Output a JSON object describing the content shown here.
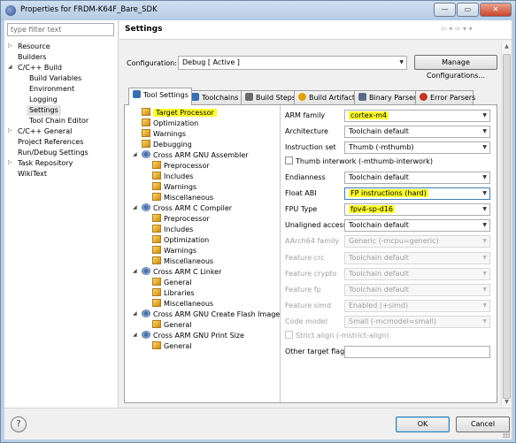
{
  "window": {
    "title": "Properties for FRDM-K64F_Bare_SDK",
    "controls": {
      "minimize": "—",
      "maximize": "▭",
      "close": "✕"
    }
  },
  "filter": {
    "placeholder": "type filter text"
  },
  "nav": {
    "items": [
      {
        "label": "Resource",
        "expander": "▷"
      },
      {
        "label": "Builders",
        "expander": ""
      },
      {
        "label": "C/C++ Build",
        "expander": "◢"
      },
      {
        "label": "Build Variables",
        "expander": ""
      },
      {
        "label": "Environment",
        "expander": ""
      },
      {
        "label": "Logging",
        "expander": ""
      },
      {
        "label": "Settings",
        "expander": ""
      },
      {
        "label": "Tool Chain Editor",
        "expander": ""
      },
      {
        "label": "C/C++ General",
        "expander": "▷"
      },
      {
        "label": "Project References",
        "expander": ""
      },
      {
        "label": "Run/Debug Settings",
        "expander": ""
      },
      {
        "label": "Task Repository",
        "expander": "▷"
      },
      {
        "label": "WikiText",
        "expander": ""
      }
    ]
  },
  "header": {
    "title": "Settings",
    "nav_arrows": "⇦ ▾ ⇨ ▾ ▾"
  },
  "configuration": {
    "label": "Configuration:",
    "value": "Debug  [ Active ]",
    "manage_label": "Manage Configurations..."
  },
  "tabs": [
    {
      "label": "Tool Settings",
      "icon": "tool-settings-icon"
    },
    {
      "label": "Toolchains",
      "icon": "toolchains-icon"
    },
    {
      "label": "Build Steps",
      "icon": "build-steps-icon"
    },
    {
      "label": "Build Artifact",
      "icon": "build-artifact-icon"
    },
    {
      "label": "Binary Parsers",
      "icon": "binary-parsers-icon"
    },
    {
      "label": "Error Parsers",
      "icon": "error-parsers-icon"
    }
  ],
  "tree": [
    {
      "label": "Target Processor",
      "expander": ""
    },
    {
      "label": "Optimization",
      "expander": ""
    },
    {
      "label": "Warnings",
      "expander": ""
    },
    {
      "label": "Debugging",
      "expander": ""
    },
    {
      "label": "Cross ARM GNU Assembler",
      "expander": "◢"
    },
    {
      "label": "Preprocessor",
      "expander": ""
    },
    {
      "label": "Includes",
      "expander": ""
    },
    {
      "label": "Warnings",
      "expander": ""
    },
    {
      "label": "Miscellaneous",
      "expander": ""
    },
    {
      "label": "Cross ARM C Compiler",
      "expander": "◢"
    },
    {
      "label": "Preprocessor",
      "expander": ""
    },
    {
      "label": "Includes",
      "expander": ""
    },
    {
      "label": "Optimization",
      "expander": ""
    },
    {
      "label": "Warnings",
      "expander": ""
    },
    {
      "label": "Miscellaneous",
      "expander": ""
    },
    {
      "label": "Cross ARM C Linker",
      "expander": "◢"
    },
    {
      "label": "General",
      "expander": ""
    },
    {
      "label": "Libraries",
      "expander": ""
    },
    {
      "label": "Miscellaneous",
      "expander": ""
    },
    {
      "label": "Cross ARM GNU Create Flash Image",
      "expander": "◢"
    },
    {
      "label": "General",
      "expander": ""
    },
    {
      "label": "Cross ARM GNU Print Size",
      "expander": "◢"
    },
    {
      "label": "General",
      "expander": ""
    }
  ],
  "props": {
    "arm_family": {
      "label": "ARM family",
      "value": "cortex-m4"
    },
    "architecture": {
      "label": "Architecture",
      "value": "Toolchain default"
    },
    "instruction_set": {
      "label": "Instruction set",
      "value": "Thumb (-mthumb)"
    },
    "thumb_interwork": {
      "label": "Thumb interwork (-mthumb-interwork)"
    },
    "endianness": {
      "label": "Endianness",
      "value": "Toolchain default"
    },
    "float_abi": {
      "label": "Float ABI",
      "value": "FP instructions (hard)"
    },
    "fpu_type": {
      "label": "FPU Type",
      "value": "fpv4-sp-d16"
    },
    "unaligned_access": {
      "label": "Unaligned access",
      "value": "Toolchain default"
    },
    "aarch64_family": {
      "label": "AArch64 family",
      "value": "Generic (-mcpu=generic)"
    },
    "feature_crc": {
      "label": "Feature crc",
      "value": "Toolchain default"
    },
    "feature_crypto": {
      "label": "Feature crypto",
      "value": "Toolchain default"
    },
    "feature_fp": {
      "label": "Feature fp",
      "value": "Toolchain default"
    },
    "feature_simd": {
      "label": "Feature simd",
      "value": "Enabled (+simd)"
    },
    "code_model": {
      "label": "Code model",
      "value": "Small (-mcmodel=small)"
    },
    "strict_align": {
      "label": "Strict align (-mstrict-align)"
    },
    "other_target_flags": {
      "label": "Other target flags",
      "value": ""
    }
  },
  "buttons": {
    "help": "?",
    "ok": "OK",
    "cancel": "Cancel"
  },
  "colors": {
    "highlight": "#ffff2e",
    "title_bar": "#bcd0e6",
    "accent_border": "#3c7fb1"
  }
}
